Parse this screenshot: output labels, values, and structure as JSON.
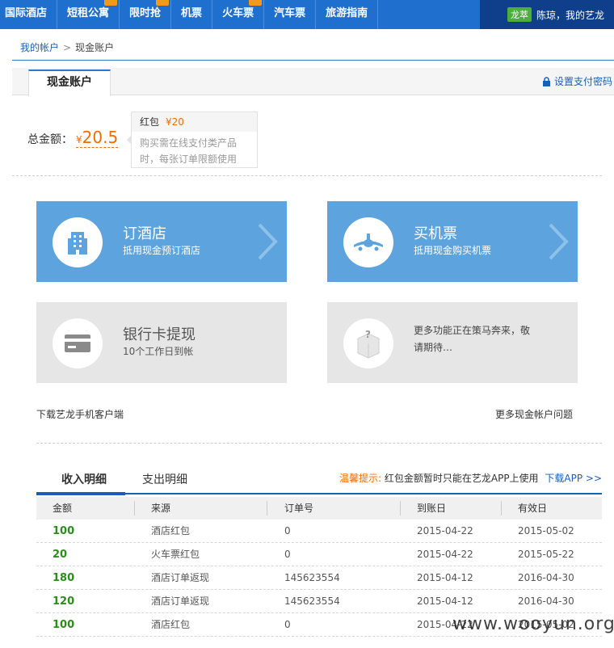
{
  "nav": {
    "items": [
      "国际酒店",
      "短租公寓",
      "限时抢",
      "机票",
      "火车票",
      "汽车票",
      "旅游指南"
    ],
    "vip_badge": "龙萃",
    "user_text": "陈琼，我的艺龙"
  },
  "breadcrumb": {
    "home": "我的帐户",
    "separator": ">",
    "current": "现金账户"
  },
  "tabbar": {
    "active_tab": "现金账户",
    "set_password": "设置支付密码"
  },
  "balance": {
    "label": "总金额：",
    "currency": "¥",
    "amount": "20.5",
    "tip": {
      "name": "红包",
      "value": "¥20",
      "desc_line1": "购买需在线支付类产品",
      "desc_line2": "时，每张订单限额使用"
    }
  },
  "cards": {
    "hotel": {
      "title": "订酒店",
      "sub": "抵用现金预订酒店",
      "icon": "hotel-building-icon"
    },
    "flight": {
      "title": "买机票",
      "sub": "抵用现金购买机票",
      "icon": "airplane-icon"
    },
    "withdraw": {
      "title": "银行卡提现",
      "sub": "10个工作日到帐",
      "icon": "bank-card-icon"
    },
    "more": {
      "line1": "更多功能正在策马奔来，敬",
      "line2": "请期待…",
      "icon": "question-box-icon"
    }
  },
  "links": {
    "download_app": "下载艺龙手机客户端",
    "faq": "更多现金帐户问题"
  },
  "detail": {
    "tab_income": "收入明细",
    "tab_expense": "支出明细",
    "notice_label": "温馨提示:",
    "notice_text": "红包金额暂时只能在艺龙APP上使用",
    "notice_link": "下载APP >>"
  },
  "table": {
    "headers": [
      "金额",
      "来源",
      "订单号",
      "到账日",
      "有效日"
    ],
    "rows": [
      [
        "100",
        "酒店红包",
        "0",
        "2015-04-22",
        "2015-05-02"
      ],
      [
        "20",
        "火车票红包",
        "0",
        "2015-04-22",
        "2015-05-22"
      ],
      [
        "180",
        "酒店订单返现",
        "145623554",
        "2015-04-12",
        "2016-04-30"
      ],
      [
        "120",
        "酒店订单返现",
        "145623554",
        "2015-04-12",
        "2016-04-30"
      ],
      [
        "100",
        "酒店红包",
        "0",
        "2015-04-22",
        "2015-05-02"
      ]
    ]
  },
  "watermark": "www.wooyun.org",
  "colors": {
    "brand_blue": "#1f6fcf",
    "accent_orange": "#f06c00",
    "amount_green": "#2e8b1e",
    "card_blue": "#5da3dd"
  }
}
